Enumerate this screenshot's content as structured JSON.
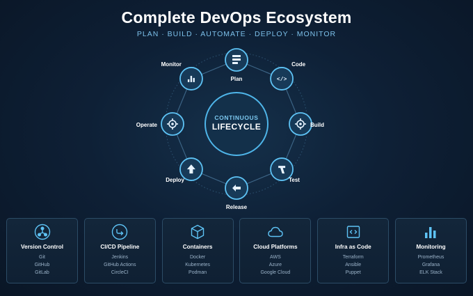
{
  "header": {
    "title": "Complete DevOps Ecosystem",
    "subtitle": "PLAN · BUILD · AUTOMATE · DEPLOY · MONITOR"
  },
  "lifecycle": {
    "center_top": "CONTINUOUS",
    "center_bottom": "LIFECYCLE",
    "stages": [
      {
        "label": "Plan",
        "icon": "plan-icon"
      },
      {
        "label": "Code",
        "icon": "code-icon"
      },
      {
        "label": "Build",
        "icon": "build-icon"
      },
      {
        "label": "Test",
        "icon": "test-icon"
      },
      {
        "label": "Release",
        "icon": "release-icon"
      },
      {
        "label": "Deploy",
        "icon": "deploy-icon"
      },
      {
        "label": "Operate",
        "icon": "operate-icon"
      },
      {
        "label": "Monitor",
        "icon": "monitor-icon"
      }
    ]
  },
  "cards": [
    {
      "title": "Version Control",
      "icon": "git-branch-icon",
      "items": [
        "Git",
        "GitHub",
        "GitLab"
      ]
    },
    {
      "title": "CI/CD Pipeline",
      "icon": "pipeline-icon",
      "items": [
        "Jenkins",
        "GitHub Actions",
        "CircleCI"
      ]
    },
    {
      "title": "Containers",
      "icon": "container-cube-icon",
      "items": [
        "Docker",
        "Kubernetes",
        "Podman"
      ]
    },
    {
      "title": "Cloud Platforms",
      "icon": "cloud-icon",
      "items": [
        "AWS",
        "Azure",
        "Google Cloud"
      ]
    },
    {
      "title": "Infra as Code",
      "icon": "code-window-icon",
      "items": [
        "Terraform",
        "Ansible",
        "Puppet"
      ]
    },
    {
      "title": "Monitoring",
      "icon": "bar-chart-icon",
      "items": [
        "Prometheus",
        "Grafana",
        "ELK Stack"
      ]
    }
  ],
  "colors": {
    "accent": "#5ec3f5",
    "node_fill": "#173a58",
    "background": "#0e2036"
  }
}
